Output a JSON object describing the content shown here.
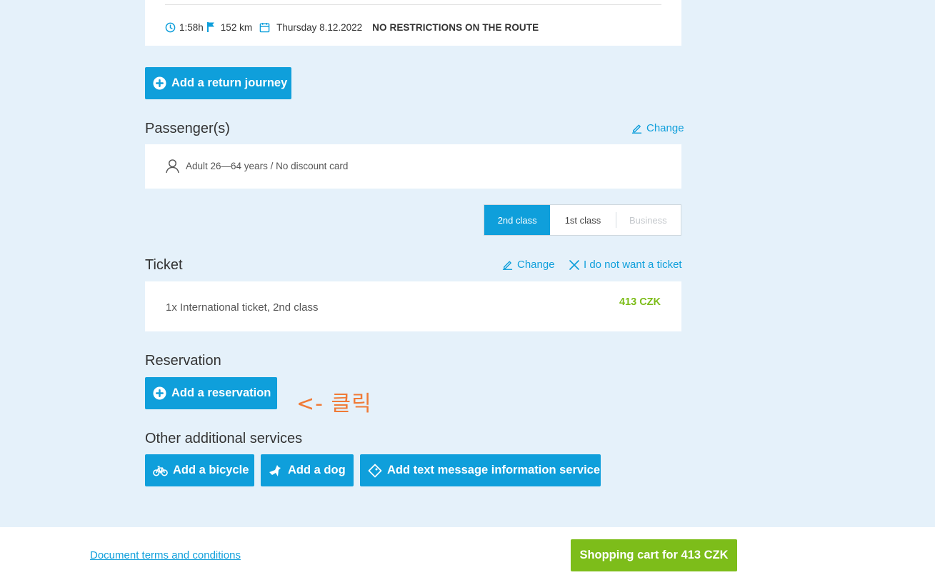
{
  "route": {
    "duration": "1:58h",
    "distance": "152 km",
    "date": "Thursday 8.12.2022",
    "restriction": "NO RESTRICTIONS ON THE ROUTE",
    "icons": [
      "clock-icon",
      "flag-icon",
      "calendar-icon"
    ]
  },
  "return_journey": {
    "label": "Add a return journey"
  },
  "passengers": {
    "title": "Passenger(s)",
    "change_label": "Change",
    "items": [
      {
        "text": "Adult 26—64 years / No discount card"
      }
    ]
  },
  "class_selector": {
    "options": [
      "2nd class",
      "1st class",
      "Business"
    ],
    "selected": "2nd class",
    "disabled": [
      "Business"
    ]
  },
  "ticket": {
    "title": "Ticket",
    "change_label": "Change",
    "remove_label": "I do not want a ticket",
    "description": "1x International ticket, 2nd class",
    "price": "413 CZK"
  },
  "reservation": {
    "title": "Reservation",
    "add_label": "Add a reservation"
  },
  "annotation": {
    "text": "<- 클릭"
  },
  "other_services": {
    "title": "Other additional services",
    "buttons": [
      {
        "label": "Add a bicycle",
        "icon": "bicycle-icon"
      },
      {
        "label": "Add a dog",
        "icon": "dog-icon"
      },
      {
        "label": "Add text message information service",
        "icon": "tag-icon"
      }
    ]
  },
  "footer": {
    "terms_link": "Document terms and conditions",
    "cart_label": "Shopping cart for 413 CZK"
  },
  "colors": {
    "accent": "#0f9fdb",
    "price_green": "#7dbd1a",
    "page_bg": "#e5f1fa",
    "annotation": "#f07a36"
  }
}
